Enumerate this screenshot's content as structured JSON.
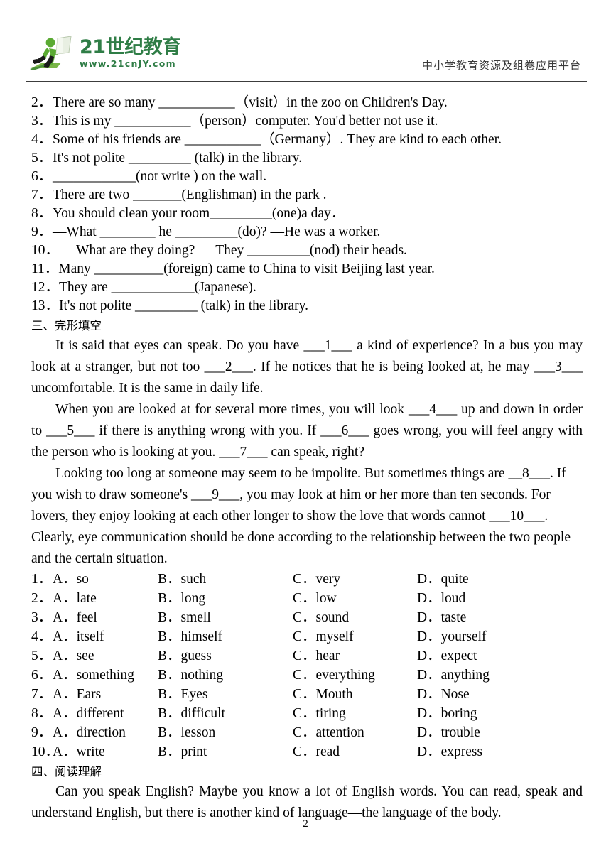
{
  "header": {
    "logo_title": "21世纪教育",
    "logo_url": "www.21cnJY.com",
    "caption": "中小学教育资源及组卷应用平台"
  },
  "fill_in_blanks": [
    {
      "num": "2．",
      "text": "There are so many ___________（visit）in the zoo on Children's Day."
    },
    {
      "num": "3．",
      "text": "This is my ___________（person）computer. You'd better not use it."
    },
    {
      "num": "4．",
      "text": "Some of his friends are ___________（Germany）. They are kind to each other."
    },
    {
      "num": "5．",
      "text": "It's not polite _________ (talk) in the library."
    },
    {
      "num": "6．",
      "text": "____________(not write ) on the wall."
    },
    {
      "num": "7．",
      "text": "There are two _______(Englishman) in the park ."
    },
    {
      "num": "8．",
      "text": "You should clean your room_________(one)a day．"
    },
    {
      "num": "9．",
      "text": "—What ________ he _________(do)? —He was a worker."
    },
    {
      "num": "10．",
      "text": "— What are they doing? — They _________(nod) their heads."
    },
    {
      "num": "11．",
      "text": "Many __________(foreign) came to China to visit Beijing last year."
    },
    {
      "num": "12．",
      "text": "They are ____________(Japanese)."
    },
    {
      "num": "13．",
      "text": "It's not polite _________ (talk) in the library."
    }
  ],
  "cloze_section": {
    "heading": "三、完形填空",
    "paragraphs": [
      "It is said that eyes can speak. Do you have ___1___ a kind of experience? In a bus you may look at a stranger, but not too ___2___. If he notices that he is being looked at, he may ___3___ uncomfortable. It is the same in daily life.",
      "When you are looked at for several more times, you will look ___4___ up and down in order to ___5___ if there is anything wrong with you. If ___6___ goes wrong, you will feel angry with the person who is looking at you. ___7___ can speak, right?",
      "Looking too long at someone may seem to be impolite. But sometimes things are __8___. If you wish to draw someone's ___9___, you may look at him or her more than ten seconds. For lovers, they enjoy looking at each other longer to show the love that words cannot ___10___. Clearly, eye communication should be done according to the relationship between the two people and the certain situation."
    ],
    "options": [
      {
        "num": "1．",
        "a": "A．so",
        "b": "B．such",
        "c": "C．very",
        "d": "D．quite"
      },
      {
        "num": "2．",
        "a": "A．late",
        "b": "B．long",
        "c": "C．low",
        "d": "D．loud"
      },
      {
        "num": "3．",
        "a": "A．feel",
        "b": "B．smell",
        "c": "C．sound",
        "d": "D．taste"
      },
      {
        "num": "4．",
        "a": "A．itself",
        "b": "B．himself",
        "c": "C．myself",
        "d": "D．yourself"
      },
      {
        "num": "5．",
        "a": "A．see",
        "b": "B．guess",
        "c": "C．hear",
        "d": "D．expect"
      },
      {
        "num": "6．",
        "a": "A．something",
        "b": "B．nothing",
        "c": "C．everything",
        "d": "D．anything"
      },
      {
        "num": "7．",
        "a": "A．Ears",
        "b": "B．Eyes",
        "c": "C．Mouth",
        "d": "D．Nose"
      },
      {
        "num": "8．",
        "a": "A．different",
        "b": "B．difficult",
        "c": "C．tiring",
        "d": "D．boring"
      },
      {
        "num": "9．",
        "a": "A．direction",
        "b": "B．lesson",
        "c": "C．attention",
        "d": "D．trouble"
      },
      {
        "num": "10．",
        "a": "A．write",
        "b": "B．print",
        "c": "C．read",
        "d": "D．express"
      }
    ]
  },
  "reading_section": {
    "heading": "四、阅读理解",
    "paragraph": "Can you speak English? Maybe you know a lot of English words. You can read, speak and understand English, but there is another kind of language—the language of the body."
  },
  "footer": {
    "page_number": "2"
  }
}
